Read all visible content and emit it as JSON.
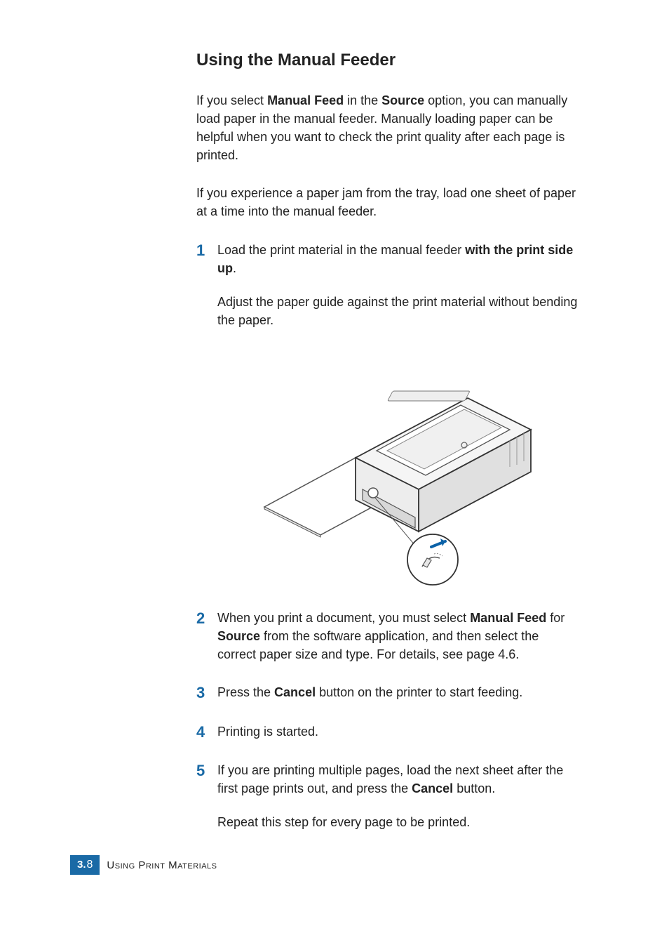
{
  "heading": "Using the Manual Feeder",
  "intro": {
    "p1_pre": "If you select ",
    "p1_b1": "Manual Feed",
    "p1_mid1": " in the ",
    "p1_b2": "Source",
    "p1_post": " option, you can manually load paper in the manual feeder. Manually loading paper can be helpful when you want to check the print quality after each page is printed.",
    "p2": "If you experience a paper jam from the tray, load one sheet of paper at a time into the manual feeder."
  },
  "steps": {
    "s1": {
      "num": "1",
      "pre": "Load the print material in the manual feeder ",
      "bold": "with the print side up",
      "post": ".",
      "sub": "Adjust the paper guide against the print material without bending the paper."
    },
    "s2": {
      "num": "2",
      "pre": "When you print a document, you must select ",
      "b1": "Manual Feed",
      "mid": " for ",
      "b2": "Source",
      "post": " from the software application, and then select the correct paper size and type. For details, see page 4.6."
    },
    "s3": {
      "num": "3",
      "pre": "Press the ",
      "b1": "Cancel",
      "post": " button on the printer to start feeding."
    },
    "s4": {
      "num": "4",
      "text": "Printing is started."
    },
    "s5": {
      "num": "5",
      "pre": "If you are printing multiple pages, load the next sheet after the first page prints out, and press the ",
      "b1": "Cancel",
      "post": " button.",
      "sub": "Repeat this step for every page to be printed."
    }
  },
  "footer": {
    "chapter": "3.",
    "page": "8",
    "section": "Using Print Materials"
  }
}
